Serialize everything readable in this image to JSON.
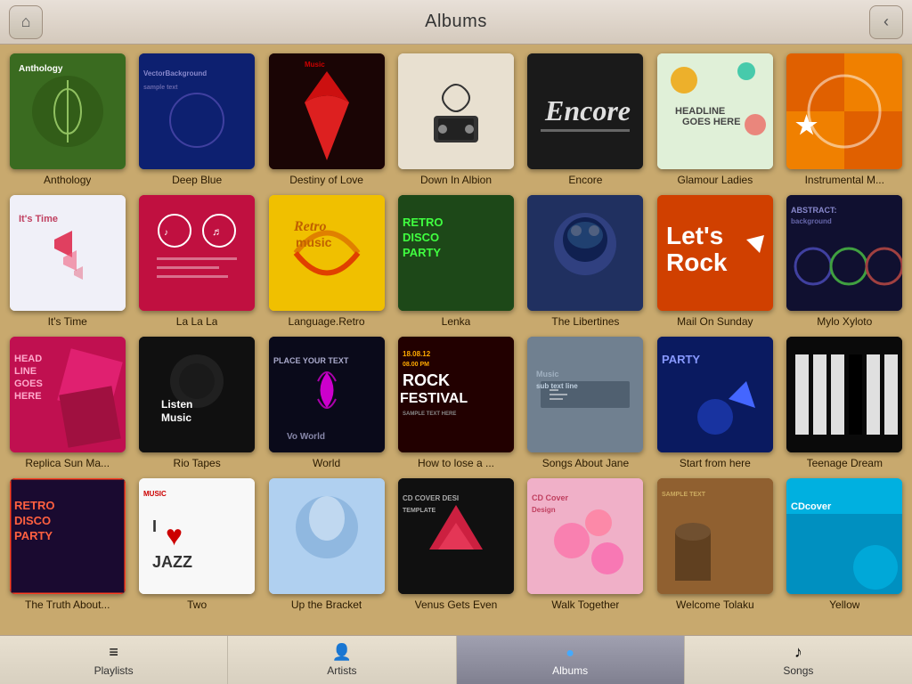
{
  "header": {
    "title": "Albums",
    "back_label": "‹",
    "home_label": "⌂"
  },
  "albums": [
    {
      "id": "anthology",
      "label": "Anthology",
      "cover_class": "cover-anthology",
      "row": 0
    },
    {
      "id": "deep-blue",
      "label": "Deep Blue",
      "cover_class": "cover-deep-blue",
      "row": 0
    },
    {
      "id": "destiny",
      "label": "Destiny of Love",
      "cover_class": "cover-destiny",
      "row": 0
    },
    {
      "id": "down-albion",
      "label": "Down In Albion",
      "cover_class": "cover-down-albion",
      "row": 0
    },
    {
      "id": "encore",
      "label": "Encore",
      "cover_class": "cover-encore",
      "row": 0
    },
    {
      "id": "glamour",
      "label": "Glamour Ladies",
      "cover_class": "cover-glamour",
      "row": 0
    },
    {
      "id": "instrumental",
      "label": "Instrumental M...",
      "cover_class": "cover-instrumental",
      "row": 0
    },
    {
      "id": "its-time",
      "label": "It's Time",
      "cover_class": "cover-its-time",
      "row": 1
    },
    {
      "id": "la-la-la",
      "label": "La La La",
      "cover_class": "cover-la-la-la",
      "row": 1
    },
    {
      "id": "language",
      "label": "Language.Retro",
      "cover_class": "cover-language",
      "row": 1
    },
    {
      "id": "lenka",
      "label": "Lenka",
      "cover_class": "cover-lenka",
      "row": 1
    },
    {
      "id": "libertines",
      "label": "The Libertines",
      "cover_class": "cover-libertines",
      "row": 1
    },
    {
      "id": "mail-sunday",
      "label": "Mail On Sunday",
      "cover_class": "cover-mail-sunday",
      "row": 1
    },
    {
      "id": "mylo",
      "label": "Mylo Xyloto",
      "cover_class": "cover-mylo",
      "row": 1
    },
    {
      "id": "replica",
      "label": "Replica Sun Ma...",
      "cover_class": "cover-replica",
      "row": 2
    },
    {
      "id": "rio",
      "label": "Rio Tapes",
      "cover_class": "cover-rio",
      "row": 2
    },
    {
      "id": "world",
      "label": "World",
      "cover_class": "cover-world",
      "row": 2
    },
    {
      "id": "rock-festival",
      "label": "How to lose a ...",
      "cover_class": "cover-rock-festival",
      "row": 2
    },
    {
      "id": "songs-jane",
      "label": "Songs About Jane",
      "cover_class": "cover-songs-jane",
      "row": 2
    },
    {
      "id": "start-here",
      "label": "Start from here",
      "cover_class": "cover-start-here",
      "row": 2
    },
    {
      "id": "teenage",
      "label": "Teenage Dream",
      "cover_class": "cover-teenage",
      "row": 2
    },
    {
      "id": "truth",
      "label": "The Truth About...",
      "cover_class": "cover-truth",
      "row": 3
    },
    {
      "id": "two",
      "label": "Two",
      "cover_class": "cover-two",
      "row": 3
    },
    {
      "id": "up-bracket",
      "label": "Up the Bracket",
      "cover_class": "cover-up-bracket",
      "row": 3
    },
    {
      "id": "venus",
      "label": "Venus Gets Even",
      "cover_class": "cover-venus",
      "row": 3
    },
    {
      "id": "walk",
      "label": "Walk Together",
      "cover_class": "cover-walk",
      "row": 3
    },
    {
      "id": "welcome",
      "label": "Welcome Tolaku",
      "cover_class": "cover-welcome",
      "row": 3
    },
    {
      "id": "yellow",
      "label": "Yellow",
      "cover_class": "cover-yellow",
      "row": 3
    }
  ],
  "nav": {
    "items": [
      {
        "id": "playlists",
        "label": "Playlists",
        "icon": "≡",
        "active": false
      },
      {
        "id": "artists",
        "label": "Artists",
        "icon": "♟",
        "active": false
      },
      {
        "id": "albums",
        "label": "Albums",
        "icon": "◉",
        "active": true
      },
      {
        "id": "songs",
        "label": "Songs",
        "icon": "♪",
        "active": false
      }
    ]
  }
}
